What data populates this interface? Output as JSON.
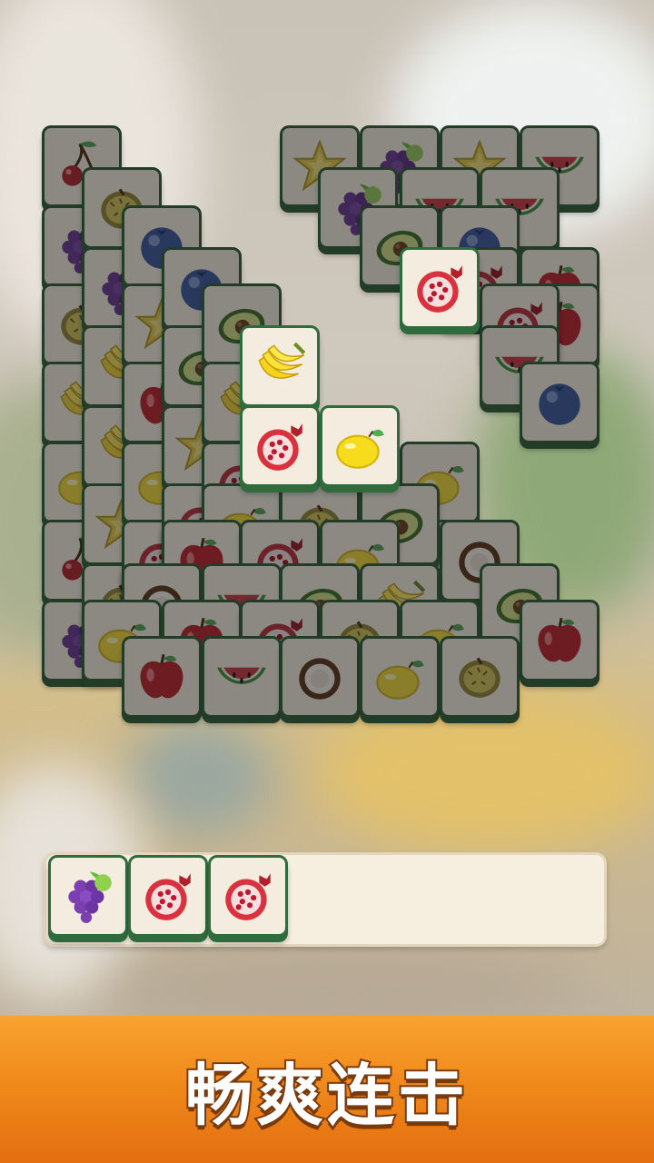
{
  "game": {
    "board_tiles": [
      "cherry",
      "grape",
      "durian",
      "banana",
      "lemon",
      "cherry",
      "grape",
      "durian",
      "grape",
      "banana",
      "banana",
      "starfruit",
      "durian",
      "blueberry",
      "starfruit",
      "apple",
      "lemon",
      "pomegranate",
      "watermelon",
      "blueberry",
      "avocado",
      "starfruit",
      "pomegranate",
      "lemon",
      "avocado",
      "banana",
      "pomegranate",
      "starfruit",
      "banana",
      "pomegranate",
      "lemon",
      "starfruit",
      "grape",
      "starfruit",
      "watermelon",
      "watermelon",
      "watermelon",
      "grape",
      "avocado",
      "blueberry",
      "pomegranate",
      "apple",
      "apple",
      "pomegranate",
      "watermelon",
      "blueberry",
      "pomegranate",
      "coconut",
      "avocado",
      "apple"
    ],
    "tray_tiles": [
      "grape",
      "pomegranate",
      "pomegranate"
    ],
    "tray_capacity": 7
  },
  "banner": {
    "text": "畅爽连击"
  }
}
